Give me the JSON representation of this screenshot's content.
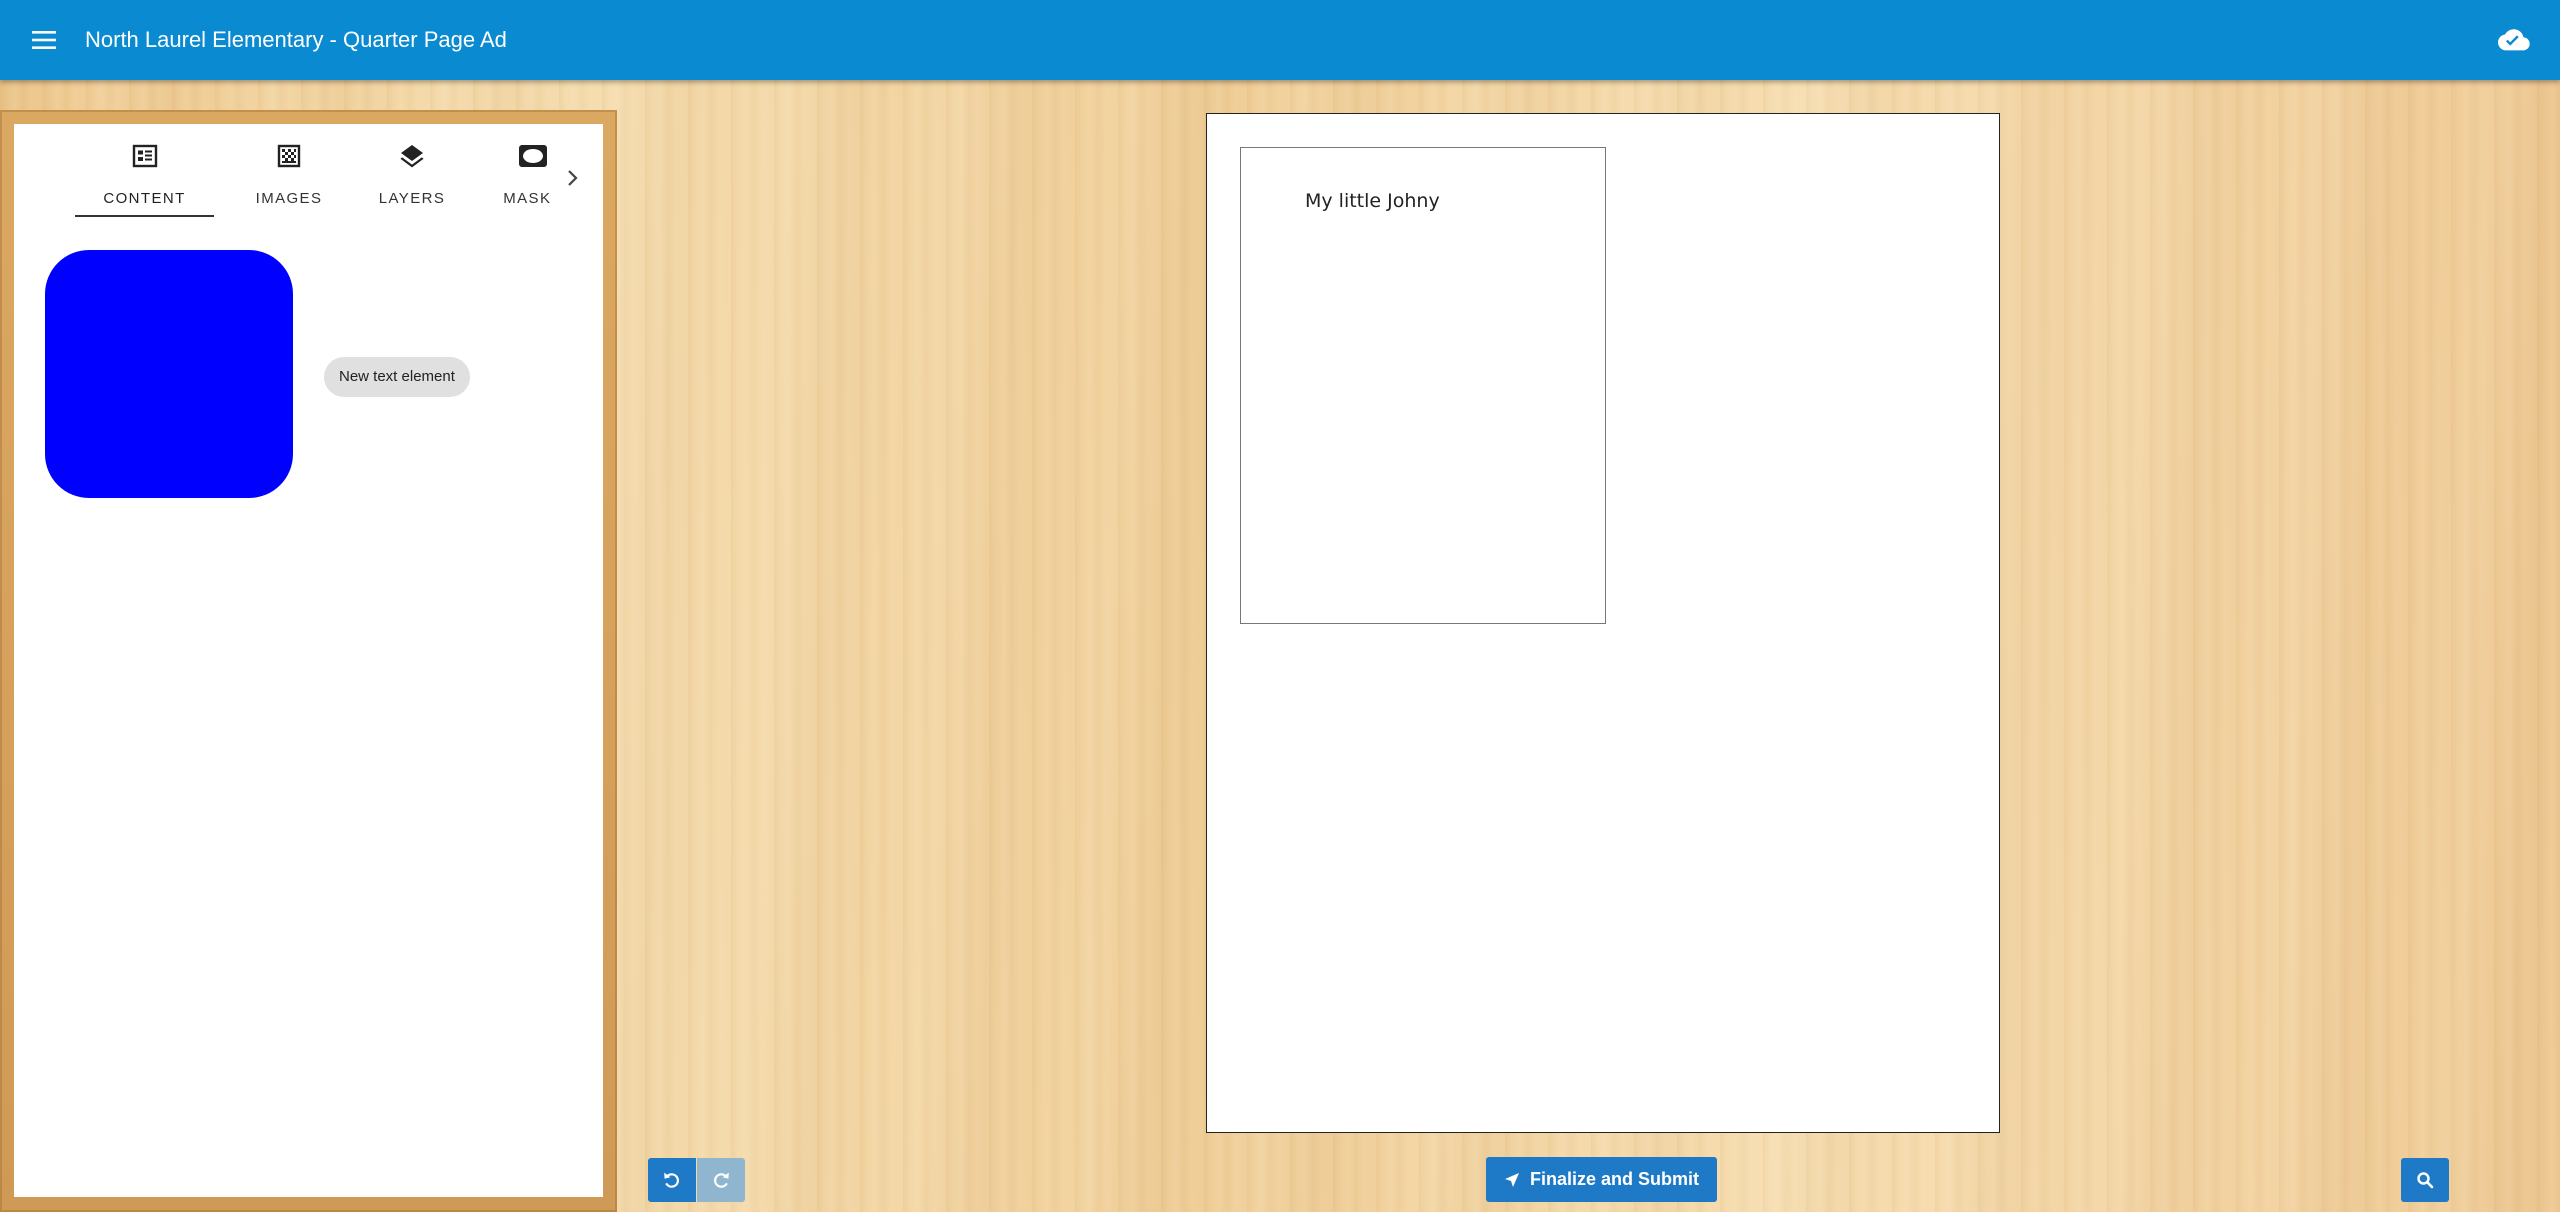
{
  "appbar": {
    "title": "North Laurel Elementary - Quarter Page Ad",
    "menu_icon": "menu-icon",
    "save_icon": "cloud-done-icon",
    "color": "#0a8ad0"
  },
  "sidebar": {
    "tabs": [
      {
        "label": "CONTENT",
        "icon": "article-icon",
        "active": true
      },
      {
        "label": "IMAGES",
        "icon": "texture-icon",
        "active": false
      },
      {
        "label": "LAYERS",
        "icon": "layers-icon",
        "active": false
      },
      {
        "label": "MASKS",
        "icon": "mask-icon",
        "active": false
      }
    ],
    "next_icon": "chevron-right-icon",
    "content": {
      "shape_color": "#0000ff",
      "text_element_label": "New text element"
    }
  },
  "canvas": {
    "text_box": {
      "text": "My little Johny"
    }
  },
  "bottom_bar": {
    "undo_icon": "undo-icon",
    "redo_icon": "redo-icon",
    "submit_label": "Finalize and Submit",
    "submit_icon": "send-icon",
    "zoom_icon": "search-icon",
    "accent": "#1e7ac6"
  }
}
